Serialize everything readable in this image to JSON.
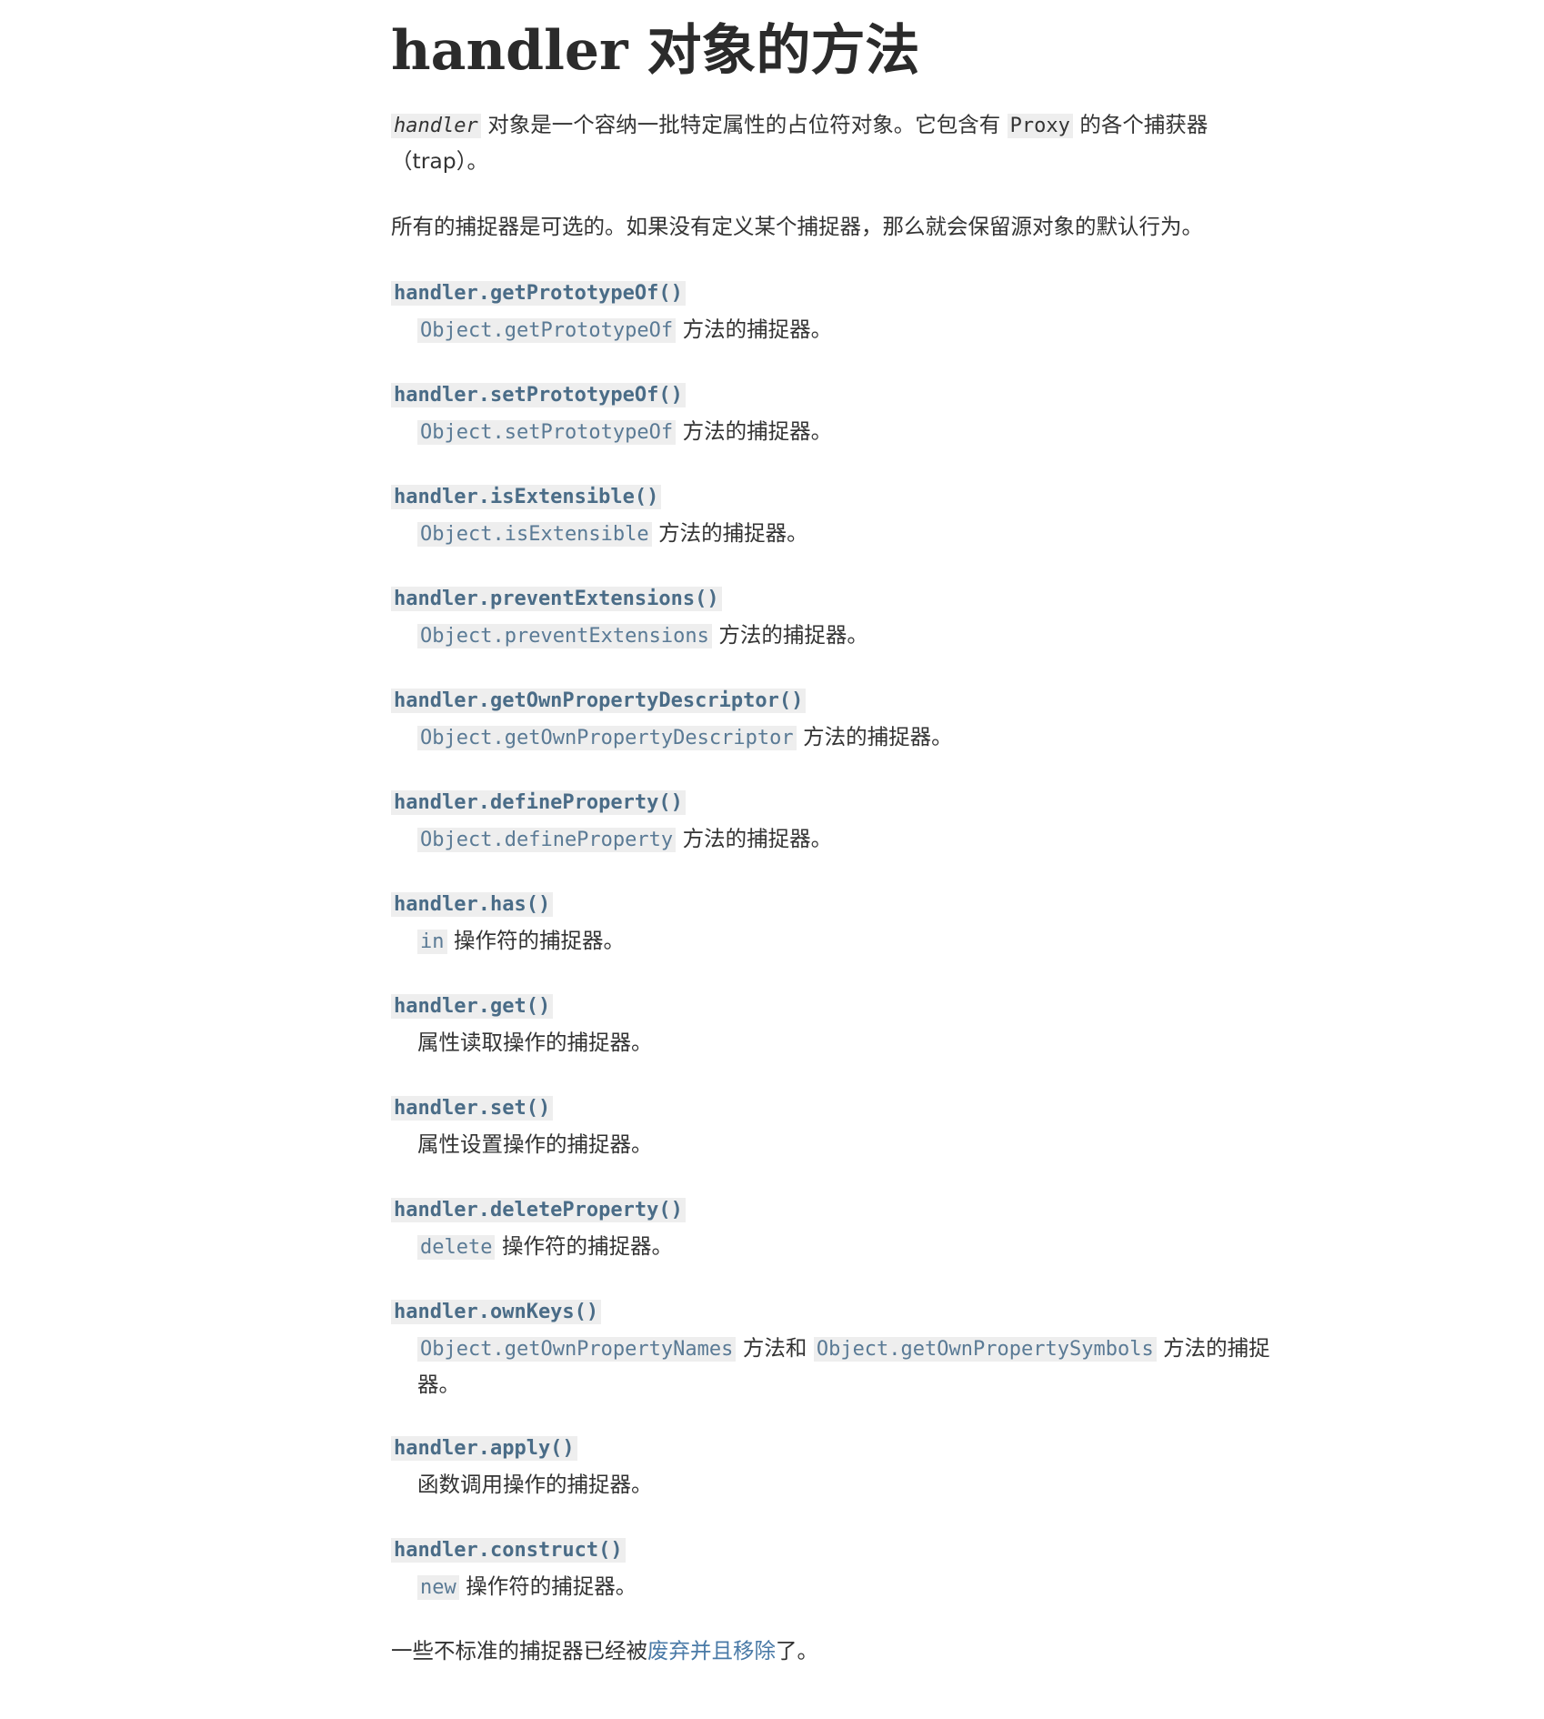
{
  "page": {
    "title": "handler 对象的方法"
  },
  "intro": {
    "code1": "handler",
    "text1": " 对象是一个容纳一批特定属性的占位符对象。它包含有 ",
    "code2": "Proxy",
    "text2": " 的各个捕获器（trap）。"
  },
  "note": {
    "text": "所有的捕捉器是可选的。如果没有定义某个捕捉器，那么就会保留源对象的默认行为。"
  },
  "entries": [
    {
      "term": "handler.getPrototypeOf()",
      "desc_code": "Object.getPrototypeOf",
      "desc_text": " 方法的捕捉器。"
    },
    {
      "term": "handler.setPrototypeOf()",
      "desc_code": "Object.setPrototypeOf",
      "desc_text": " 方法的捕捉器。"
    },
    {
      "term": "handler.isExtensible()",
      "desc_code": "Object.isExtensible",
      "desc_text": " 方法的捕捉器。"
    },
    {
      "term": "handler.preventExtensions()",
      "desc_code": "Object.preventExtensions",
      "desc_text": " 方法的捕捉器。"
    },
    {
      "term": "handler.getOwnPropertyDescriptor()",
      "desc_code": "Object.getOwnPropertyDescriptor",
      "desc_text": " 方法的捕捉器。"
    },
    {
      "term": "handler.defineProperty()",
      "desc_code": "Object.defineProperty",
      "desc_text": " 方法的捕捉器。"
    },
    {
      "term": "handler.has()",
      "desc_code": "in",
      "desc_text": " 操作符的捕捉器。"
    },
    {
      "term": "handler.get()",
      "desc_text": "属性读取操作的捕捉器。"
    },
    {
      "term": "handler.set()",
      "desc_text": "属性设置操作的捕捉器。"
    },
    {
      "term": "handler.deleteProperty()",
      "desc_code": "delete",
      "desc_text": " 操作符的捕捉器。"
    },
    {
      "term": "handler.ownKeys()",
      "desc_code": "Object.getOwnPropertyNames",
      "desc_text": " 方法和 ",
      "desc_code2": "Object.getOwnPropertySymbols",
      "desc_text2": " 方法的捕捉器。"
    },
    {
      "term": "handler.apply()",
      "desc_text": "函数调用操作的捕捉器。"
    },
    {
      "term": "handler.construct()",
      "desc_code": "new",
      "desc_text": " 操作符的捕捉器。"
    }
  ],
  "footer": {
    "text1": "一些不标准的捕捉器已经被",
    "link": "废弃并且移除",
    "text2": "了。"
  }
}
